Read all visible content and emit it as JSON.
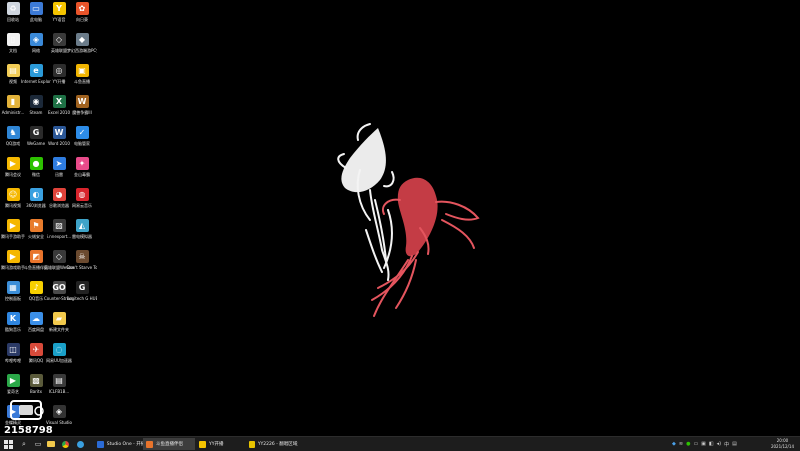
{
  "desktop": {
    "icons": [
      {
        "label": "回收站",
        "color": "#cfd6df",
        "glyph": "♻",
        "col": 0,
        "row": 0
      },
      {
        "label": "此电脑",
        "color": "#3c7ad6",
        "glyph": "▭",
        "col": 1,
        "row": 0
      },
      {
        "label": "YY语音",
        "color": "#f5c400",
        "glyph": "Y",
        "col": 2,
        "row": 0
      },
      {
        "label": "向日葵",
        "color": "#e9542a",
        "glyph": "✿",
        "col": 3,
        "row": 0
      },
      {
        "label": "文档",
        "color": "#f2f2f2",
        "glyph": "▯",
        "col": 0,
        "row": 1
      },
      {
        "label": "网络",
        "color": "#3a89d8",
        "glyph": "◈",
        "col": 1,
        "row": 1
      },
      {
        "label": "英雄联盟",
        "color": "#3a3a3a",
        "glyph": "◇",
        "col": 2,
        "row": 1
      },
      {
        "label": "梦幻西游端游PC完整版",
        "color": "#6b7c8a",
        "glyph": "◆",
        "col": 3,
        "row": 1
      },
      {
        "label": "视频",
        "color": "#f2cc55",
        "glyph": "▤",
        "col": 0,
        "row": 2
      },
      {
        "label": "Internet Explorer",
        "color": "#2b9ad8",
        "glyph": "e",
        "col": 1,
        "row": 2
      },
      {
        "label": "YY开播",
        "color": "#2d2d2d",
        "glyph": "◎",
        "col": 2,
        "row": 2
      },
      {
        "label": "斗鱼直播",
        "color": "#f0b400",
        "glyph": "▣",
        "col": 3,
        "row": 2
      },
      {
        "label": "Administr...",
        "color": "#e2b23a",
        "glyph": "▮",
        "col": 0,
        "row": 3
      },
      {
        "label": "Steam",
        "color": "#1b2838",
        "glyph": "◉",
        "col": 1,
        "row": 3
      },
      {
        "label": "Excel 2010",
        "color": "#1e7145",
        "glyph": "X",
        "col": 2,
        "row": 3
      },
      {
        "label": "魔兽争霸III",
        "color": "#a0621f",
        "glyph": "W",
        "col": 3,
        "row": 3
      },
      {
        "label": "QQ游戏",
        "color": "#2f86d6",
        "glyph": "♞",
        "col": 0,
        "row": 4
      },
      {
        "label": "WeGame",
        "color": "#2a2a2a",
        "glyph": "G",
        "col": 1,
        "row": 4
      },
      {
        "label": "Word 2010",
        "color": "#2b5797",
        "glyph": "W",
        "col": 2,
        "row": 4
      },
      {
        "label": "电脑管家",
        "color": "#2d8ce8",
        "glyph": "✓",
        "col": 3,
        "row": 4
      },
      {
        "label": "腾讯会议",
        "color": "#f6b900",
        "glyph": "▶",
        "col": 0,
        "row": 5
      },
      {
        "label": "微信",
        "color": "#2dc100",
        "glyph": "●",
        "col": 1,
        "row": 5
      },
      {
        "label": "迅雷",
        "color": "#2f7de0",
        "glyph": "➤",
        "col": 2,
        "row": 5
      },
      {
        "label": "金山毒霸",
        "color": "#e84b8a",
        "glyph": "✦",
        "col": 3,
        "row": 5
      },
      {
        "label": "腾讯视频",
        "color": "#f5b700",
        "glyph": "☺",
        "col": 0,
        "row": 6
      },
      {
        "label": "360浏览器",
        "color": "#3aa0e0",
        "glyph": "◐",
        "col": 1,
        "row": 6
      },
      {
        "label": "谷歌浏览器",
        "color": "#e0433a",
        "glyph": "◕",
        "col": 2,
        "row": 6
      },
      {
        "label": "网易云音乐",
        "color": "#d8242c",
        "glyph": "◍",
        "col": 3,
        "row": 6
      },
      {
        "label": "腾讯手游助手",
        "color": "#f5b700",
        "glyph": "▶",
        "col": 0,
        "row": 7
      },
      {
        "label": "火绒安全",
        "color": "#e87c2c",
        "glyph": "⚑",
        "col": 1,
        "row": 7
      },
      {
        "label": "i.nnexport...",
        "color": "#3a3a3a",
        "glyph": "▨",
        "col": 2,
        "row": 7
      },
      {
        "label": "雷电模拟器",
        "color": "#3ea3c8",
        "glyph": "◭",
        "col": 3,
        "row": 7
      },
      {
        "label": "腾讯游戏助手",
        "color": "#f5b700",
        "glyph": "▶",
        "col": 0,
        "row": 8
      },
      {
        "label": "斗鱼直播伴侣",
        "color": "#e8742c",
        "glyph": "◩",
        "col": 1,
        "row": 8
      },
      {
        "label": "英雄联盟WeGame版",
        "color": "#3a3a3a",
        "glyph": "◇",
        "col": 2,
        "row": 8
      },
      {
        "label": "Don't Starve Together",
        "color": "#6b4a2f",
        "glyph": "☠",
        "col": 3,
        "row": 8
      },
      {
        "label": "控制面板",
        "color": "#3b8ed8",
        "glyph": "▦",
        "col": 0,
        "row": 9
      },
      {
        "label": "QQ音乐",
        "color": "#f6d000",
        "glyph": "♪",
        "col": 1,
        "row": 9
      },
      {
        "label": "Counter-Strike Global Off...",
        "color": "#4a4a4a",
        "glyph": "GO",
        "col": 2,
        "row": 9
      },
      {
        "label": "Logitech G HUB",
        "color": "#222",
        "glyph": "G",
        "col": 3,
        "row": 9
      },
      {
        "label": "酷狗音乐",
        "color": "#2f86e0",
        "glyph": "K",
        "col": 0,
        "row": 10
      },
      {
        "label": "百度网盘",
        "color": "#3b8fe8",
        "glyph": "☁",
        "col": 1,
        "row": 10
      },
      {
        "label": "新建文件夹",
        "color": "#f2c94c",
        "glyph": "▰",
        "col": 2,
        "row": 10
      },
      {
        "label": "哔哩哔哩",
        "color": "#2b3a66",
        "glyph": "◫",
        "col": 0,
        "row": 11
      },
      {
        "label": "腾讯QQ",
        "color": "#d84a3a",
        "glyph": "✈",
        "col": 1,
        "row": 11
      },
      {
        "label": "网易UU加速器",
        "color": "#1aa0c8",
        "glyph": "◌",
        "col": 2,
        "row": 11
      },
      {
        "label": "爱奇艺",
        "color": "#2aa848",
        "glyph": "▶",
        "col": 0,
        "row": 12
      },
      {
        "label": "Baritx",
        "color": "#5a5a3a",
        "glyph": "▩",
        "col": 1,
        "row": 12
      },
      {
        "label": "ICLFB1B...",
        "color": "#3a3a3a",
        "glyph": "▤",
        "col": 2,
        "row": 12
      },
      {
        "label": "金蝶精灵",
        "color": "#3a7ad8",
        "glyph": "▶",
        "col": 0,
        "row": 13
      },
      {
        "label": "Visual Studio",
        "color": "#333",
        "glyph": "◈",
        "col": 2,
        "row": 13
      }
    ]
  },
  "watermark": {
    "id": "2158798"
  },
  "taskbar": {
    "start_icon": "windows-logo-icon",
    "search_icon": "search-icon",
    "windows": [
      {
        "title": "Studio One - 开播",
        "color": "#2b6bd6",
        "active": false
      },
      {
        "title": "斗鱼直播伴侣",
        "color": "#e8742c",
        "active": true
      },
      {
        "title": "YY开播",
        "color": "#f5c400",
        "active": false
      },
      {
        "title": "YY2226 - 翻唱区域主流",
        "color": "#e8c400",
        "active": false
      }
    ],
    "clock": {
      "time": "20:00",
      "date": "2021/12/14"
    }
  }
}
